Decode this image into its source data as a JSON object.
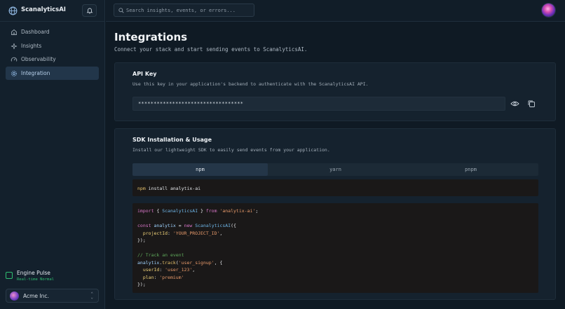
{
  "brand": {
    "name": "ScanalyticsAI"
  },
  "search": {
    "placeholder": "Search insights, events, or errors..."
  },
  "nav": {
    "items": [
      {
        "label": "Dashboard",
        "icon": "home-icon"
      },
      {
        "label": "Insights",
        "icon": "sparkles-icon"
      },
      {
        "label": "Observability",
        "icon": "gauge-icon"
      },
      {
        "label": "Integration",
        "icon": "settings-icon",
        "active": true
      }
    ]
  },
  "engine_pulse": {
    "title": "Engine Pulse",
    "status": "Real-time Normal",
    "status_color": "#2fbf71"
  },
  "org": {
    "name": "Acme Inc."
  },
  "page": {
    "title": "Integrations",
    "subtitle": "Connect your stack and start sending events to ScanalyticsAI."
  },
  "api_key": {
    "title": "API Key",
    "description": "Use this key in your application's backend to authenticate with the ScanalyticsAI API.",
    "masked_value": "**********************************"
  },
  "sdk": {
    "title": "SDK Installation & Usage",
    "description": "Install our lightweight SDK to easily send events from your application.",
    "tabs": [
      "npm",
      "yarn",
      "pnpm"
    ],
    "active_tab": "npm",
    "install_command": {
      "cmd": "npm",
      "rest": " install analytix-ai"
    },
    "code": {
      "l1_kw": "import",
      "l1_a": " { ",
      "l1_cls": "ScanalyticsAI",
      "l1_b": " } ",
      "l1_from": "from",
      "l1_str": " 'analytix-ai'",
      "l1_end": ";",
      "l3_kw": "const",
      "l3_var": " analytix",
      "l3_eq": " = ",
      "l3_new": "new",
      "l3_cls": " ScanalyticsAI",
      "l3_end": "({",
      "l4_prop": "  projectId",
      "l4_colon": ": ",
      "l4_str": "'YOUR_PROJECT_ID'",
      "l4_end": ",",
      "l5": "});",
      "l7_com": "// Track an event",
      "l8_var": "analytix",
      "l8_dot": ".",
      "l8_fn": "track",
      "l8_open": "(",
      "l8_str": "'user_signup'",
      "l8_end": ", {",
      "l9_prop": "  userId",
      "l9_colon": ": ",
      "l9_str": "'user_123'",
      "l9_end": ",",
      "l10_prop": "  plan",
      "l10_colon": ": ",
      "l10_str": "'premium'",
      "l11": "});"
    }
  }
}
